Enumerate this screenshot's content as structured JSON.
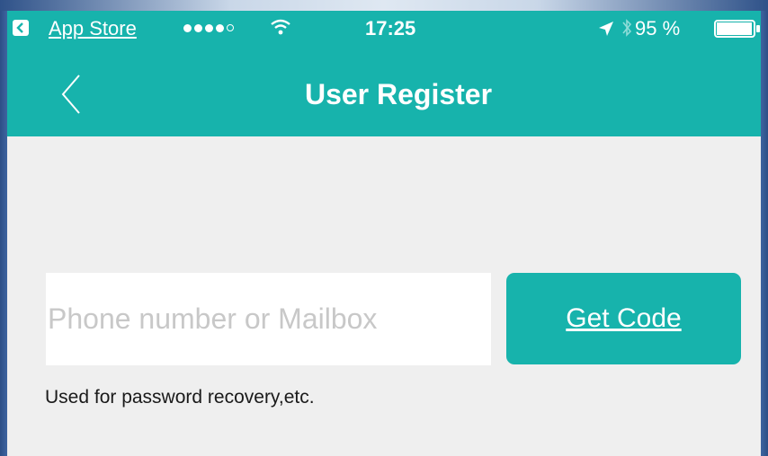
{
  "status_bar": {
    "back_app_label": "App Store",
    "time": "17:25",
    "battery_percent": "95 %",
    "signal_bars_filled": 4,
    "signal_bars_total": 5,
    "battery_level": 0.95
  },
  "nav": {
    "title": "User Register"
  },
  "form": {
    "contact_input": {
      "placeholder": "Phone number or Mailbox",
      "value": ""
    },
    "get_code_label": "Get Code",
    "hint": "Used for password recovery,etc."
  },
  "colors": {
    "accent": "#17b3ac",
    "page_background": "#efefef"
  },
  "icons": [
    "back-chevron-icon",
    "wifi-icon",
    "location-icon",
    "bluetooth-icon",
    "battery-icon"
  ]
}
